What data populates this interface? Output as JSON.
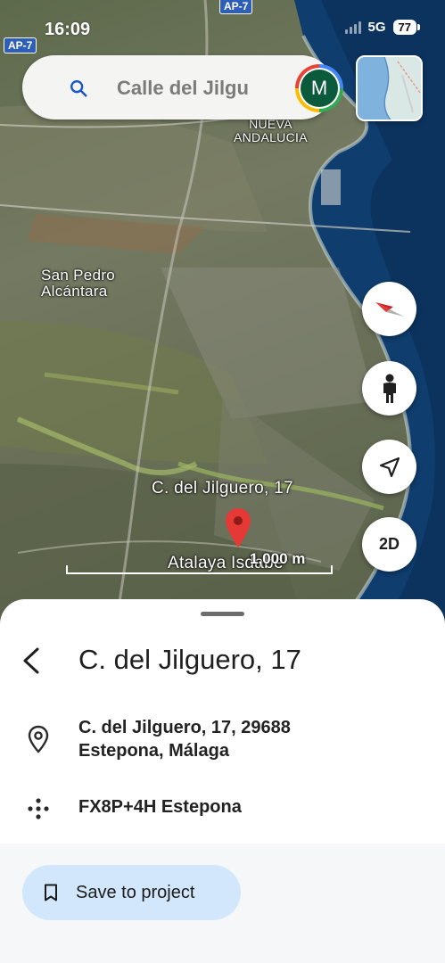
{
  "status_bar": {
    "time": "16:09",
    "network": "5G",
    "battery": "77"
  },
  "map": {
    "labels": {
      "area_nueva": "NUEVA\nANDALUCIA",
      "san_pedro": "San Pedro\nAlcántara",
      "street": "C. del Jilguero, 17",
      "atalaya": "Atalaya Isdabe"
    },
    "road_shields": [
      "AP-7",
      "AP-7"
    ],
    "scale_label": "1,000 m",
    "view_mode_button": "2D"
  },
  "search": {
    "query": "Calle del Jilgu",
    "avatar_letter": "M"
  },
  "place": {
    "title": "C. del Jilguero, 17",
    "address_line1": "C. del Jilguero, 17, 29688",
    "address_line2": "Estepona, Málaga",
    "plus_code": "FX8P+4H Estepona"
  },
  "actions": {
    "save_label": "Save to project"
  },
  "colors": {
    "accent_button_bg": "#d2e7fb",
    "pin_red": "#e53935",
    "sea": "#0f3d6e",
    "avatar_bg": "#0b5a3c"
  },
  "icons": [
    "search-icon",
    "back-arrow-icon",
    "location-pin-icon",
    "plus-code-icon",
    "bookmark-icon",
    "compass-icon",
    "pegman-icon",
    "navigation-arrow-icon"
  ]
}
